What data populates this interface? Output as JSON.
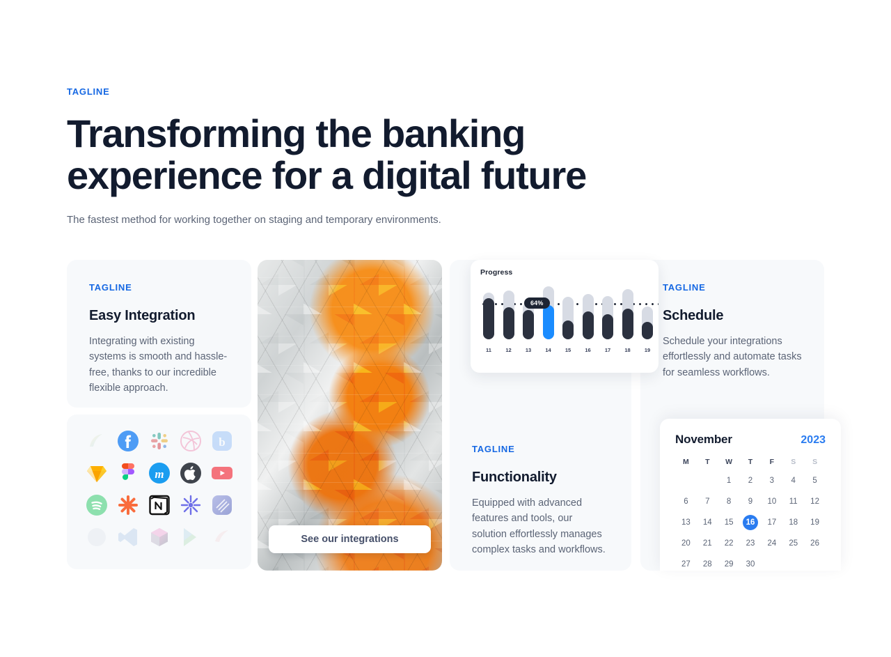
{
  "header": {
    "tagline": "TAGLINE",
    "title": "Transforming the banking experience for a digital future",
    "subtitle": "The fastest method for working together on staging and temporary environments."
  },
  "cards": {
    "easy_integration": {
      "tagline": "TAGLINE",
      "title": "Easy Integration",
      "body": "Integrating with existing systems is smooth and hassle-free, thanks to our incredible flexible approach."
    },
    "functionality": {
      "tagline": "TAGLINE",
      "title": "Functionality",
      "body": "Equipped with advanced features and tools, our solution effortlessly manages complex tasks and workflows."
    },
    "schedule": {
      "tagline": "TAGLINE",
      "title": "Schedule",
      "body": "Schedule your integrations effortlessly and automate tasks for seamless workflows."
    }
  },
  "integrations_image": {
    "button_label": "See our integrations"
  },
  "integration_icons": [
    {
      "name": "arc-icon",
      "row": 1
    },
    {
      "name": "facebook-icon",
      "row": 1
    },
    {
      "name": "slack-icon",
      "row": 1
    },
    {
      "name": "dribbble-icon",
      "row": 1
    },
    {
      "name": "blogger-icon",
      "row": 1
    },
    {
      "name": "sketch-icon",
      "row": 2
    },
    {
      "name": "figma-icon",
      "row": 2
    },
    {
      "name": "mailchimp-icon",
      "row": 2
    },
    {
      "name": "apple-icon",
      "row": 2
    },
    {
      "name": "youtube-icon",
      "row": 2
    },
    {
      "name": "spotify-icon",
      "row": 3
    },
    {
      "name": "zapier-icon",
      "row": 3
    },
    {
      "name": "notion-icon",
      "row": 3
    },
    {
      "name": "gatsby-icon",
      "row": 3
    },
    {
      "name": "linear-icon",
      "row": 3
    },
    {
      "name": "sphere-icon",
      "row": 4
    },
    {
      "name": "vscode-icon",
      "row": 4
    },
    {
      "name": "cube-icon",
      "row": 4
    },
    {
      "name": "google-play-icon",
      "row": 4
    },
    {
      "name": "swirl-icon",
      "row": 4
    }
  ],
  "progress_widget": {
    "title": "Progress",
    "highlight_label": "64%"
  },
  "chart_data": {
    "type": "bar",
    "title": "Progress",
    "categories": [
      "11",
      "12",
      "13",
      "14",
      "15",
      "16",
      "17",
      "18",
      "19"
    ],
    "values": [
      78,
      60,
      55,
      64,
      35,
      52,
      48,
      58,
      33
    ],
    "track_values": [
      88,
      92,
      70,
      100,
      80,
      86,
      82,
      95,
      62
    ],
    "highlight_index": 3,
    "highlight_label": "64%",
    "threshold_line": 72,
    "xlabel": "",
    "ylabel": "",
    "ylim": [
      0,
      100
    ],
    "grid": false,
    "legend": "none",
    "colors": {
      "bar": "#2b313f",
      "highlight": "#1a8cff",
      "track": "#d7dbe4",
      "threshold": "#1d2433"
    }
  },
  "calendar": {
    "month": "November",
    "year": "2023",
    "day_headers": [
      "M",
      "T",
      "W",
      "T",
      "F",
      "S",
      "S"
    ],
    "selected_day": "16",
    "weeks": [
      [
        "",
        "",
        "1",
        "2",
        "3",
        "4",
        "5"
      ],
      [
        "6",
        "7",
        "8",
        "9",
        "10",
        "11",
        "12"
      ],
      [
        "13",
        "14",
        "15",
        "16",
        "17",
        "18",
        "19"
      ],
      [
        "20",
        "21",
        "22",
        "23",
        "24",
        "25",
        "26"
      ],
      [
        "27",
        "28",
        "29",
        "30",
        "",
        "",
        ""
      ]
    ]
  },
  "colors": {
    "accent": "#1668e3",
    "calendar_accent": "#2a7cf0",
    "heading": "#121b2e",
    "body_text": "#5b6476",
    "panel_bg": "#f7f9fb",
    "page_bg": "#ffffff"
  }
}
